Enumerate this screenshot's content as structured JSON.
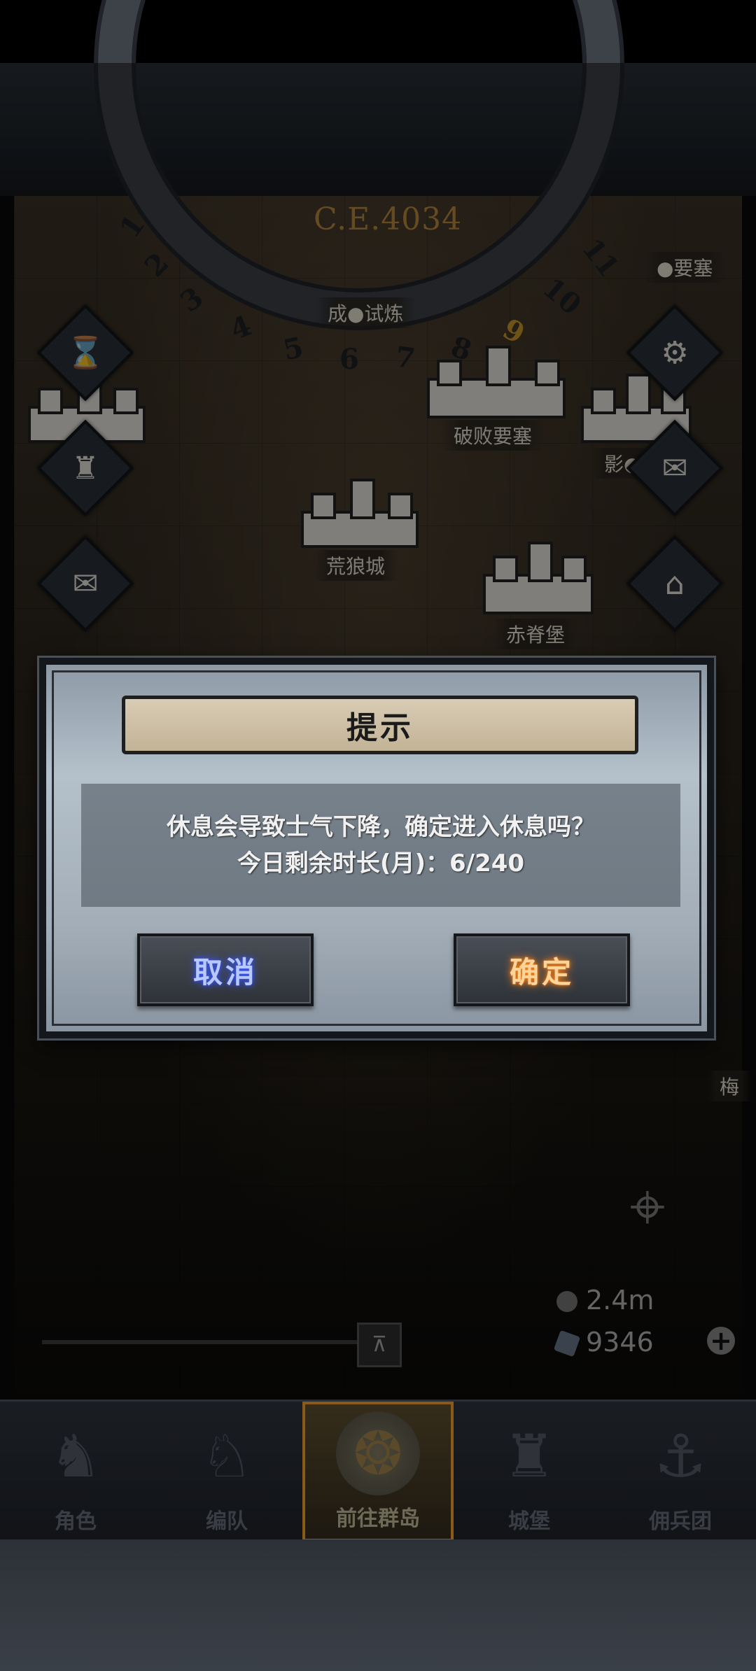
{
  "map": {
    "year": "C.E.4034",
    "dial_numbers": [
      "1",
      "2",
      "3",
      "4",
      "5",
      "6",
      "7",
      "8",
      "9",
      "10",
      "11"
    ],
    "highlighted_number": "9",
    "labels": {
      "trial": "成●试炼",
      "ruined_fortress": "破败要塞",
      "wild_wolf_city": "荒狼城",
      "red_spine_fort": "赤脊堡",
      "shadow": "影●",
      "fortress_top": "●要塞",
      "plum": "梅"
    }
  },
  "resources": {
    "silver": "2.4m",
    "crystal": "9346"
  },
  "dialog": {
    "title": "提示",
    "line1": "休息会导致士气下降，确定进入休息吗？",
    "line2": "今日剩余时长(月)：6/240",
    "cancel_label": "取消",
    "confirm_label": "确定"
  },
  "nav": {
    "items": [
      {
        "label": "角色",
        "icon": "knight-helmet-icon"
      },
      {
        "label": "编队",
        "icon": "armored-knight-icon"
      },
      {
        "label": "前往群岛",
        "icon": "island-map-icon"
      },
      {
        "label": "城堡",
        "icon": "castle-icon"
      },
      {
        "label": "佣兵团",
        "icon": "mercenary-ship-icon"
      }
    ],
    "active_index": 2
  },
  "colors": {
    "cancel_glow": "#3a5cff",
    "confirm_glow": "#ff8a1a",
    "year_gold": "#b8893e"
  }
}
